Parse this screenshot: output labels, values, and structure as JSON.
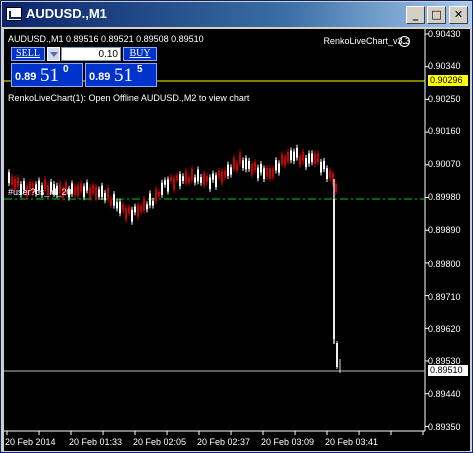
{
  "window": {
    "title": "AUDUSD.,M1",
    "controls": {
      "minimize": "_",
      "maximize": "□",
      "close": "✕"
    }
  },
  "chart": {
    "info_line": "AUDUSD.,M1  0.89516 0.89521 0.89508 0.89510",
    "indicator_name": "RenkoLiveChart_v3.3",
    "indicator_icon": "smiley-icon",
    "message": "RenkoLiveChart(1): Open Offline AUDUSD.,M2 to view chart",
    "watermark": "#user?cs_id_20",
    "colors": {
      "background": "#000000",
      "bull_candle": "#ffffff",
      "bear_candle": "#cc0000",
      "ask_line": "#ffff00",
      "bid_line": "#ffffff",
      "green_level": "#00cc00",
      "axis": "#ffffff"
    }
  },
  "trade_panel": {
    "sell_label": "SELL",
    "buy_label": "BUY",
    "lot_value": "0.10",
    "sell_price": {
      "prefix": "0.89",
      "big": "51",
      "sup": "0"
    },
    "buy_price": {
      "prefix": "0.89",
      "big": "51",
      "sup": "5"
    }
  },
  "price_axis": {
    "labels": [
      "0.90430",
      "0.90340",
      "0.90250",
      "0.90160",
      "0.90070",
      "0.89980",
      "0.89890",
      "0.89800",
      "0.89710",
      "0.89620",
      "0.89530",
      "0.89440",
      "0.89350"
    ],
    "ask_tag": "0.90296",
    "bid_tag": "0.89510"
  },
  "time_axis": {
    "labels": [
      "20 Feb 2014",
      "20 Feb 01:33",
      "20 Feb 02:05",
      "20 Feb 02:37",
      "20 Feb 03:09",
      "20 Feb 03:41"
    ]
  }
}
